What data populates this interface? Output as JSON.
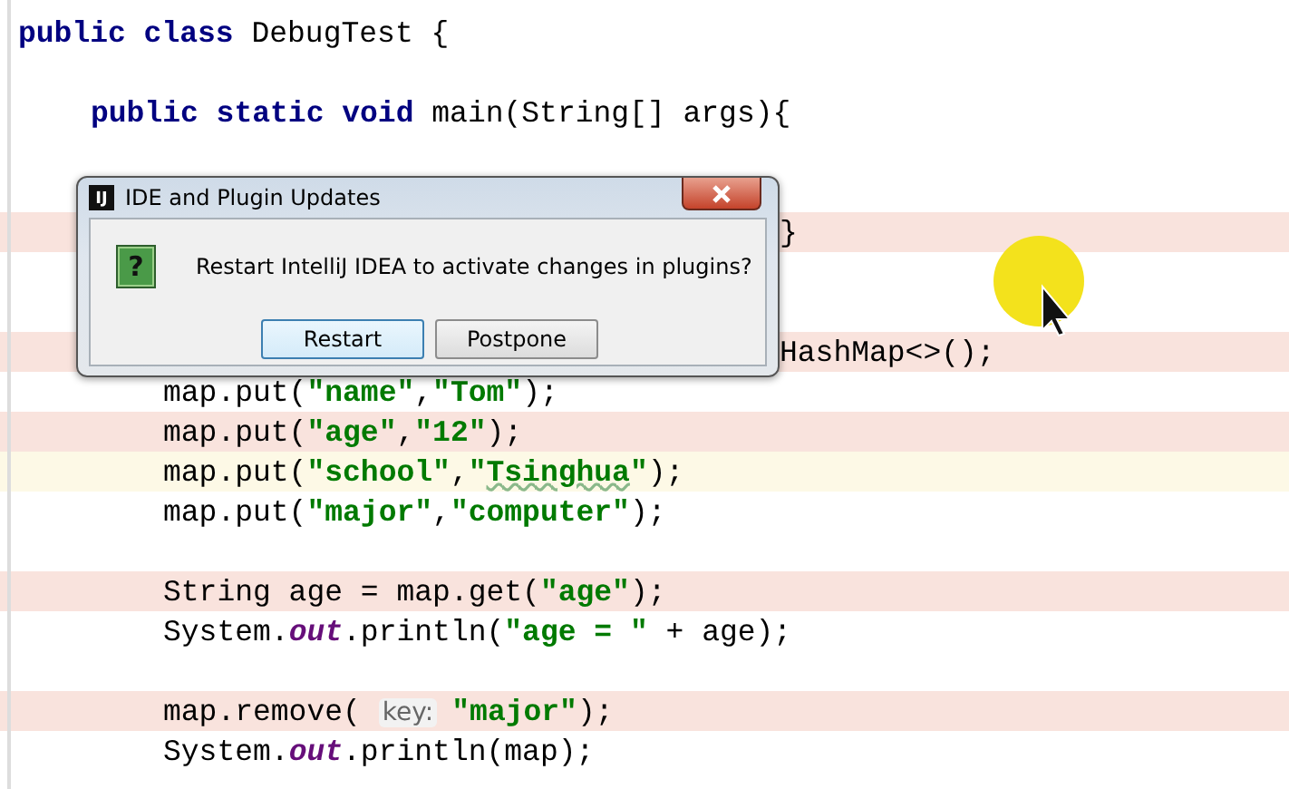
{
  "editor": {
    "lines": [
      {
        "kind": "class",
        "breakpoint": false,
        "current": false,
        "tokens": [
          {
            "kind": "keyword",
            "text": "public class"
          },
          {
            "kind": "plain",
            "text": " DebugTest {"
          }
        ]
      },
      {
        "kind": "blank",
        "breakpoint": false,
        "current": false
      },
      {
        "kind": "member",
        "breakpoint": false,
        "current": false,
        "tokens": [
          {
            "kind": "keyword",
            "text": "public static void"
          },
          {
            "kind": "plain",
            "text": " main(String[] args){"
          }
        ]
      },
      {
        "kind": "blank",
        "breakpoint": false,
        "current": false
      },
      {
        "kind": "blank",
        "breakpoint": false,
        "current": false
      },
      {
        "kind": "covered",
        "breakpoint": true,
        "current": false,
        "tokens": [
          {
            "kind": "plain",
            "text": "}"
          }
        ]
      },
      {
        "kind": "blank",
        "breakpoint": false,
        "current": false
      },
      {
        "kind": "blank",
        "breakpoint": false,
        "current": false
      },
      {
        "kind": "covered",
        "breakpoint": true,
        "current": false,
        "tokens": [
          {
            "kind": "plain",
            "text": "HashMap<>();"
          }
        ]
      },
      {
        "kind": "body",
        "breakpoint": false,
        "current": false,
        "tokens": [
          {
            "kind": "plain",
            "text": "map.put("
          },
          {
            "kind": "string",
            "text": "\"name\""
          },
          {
            "kind": "plain",
            "text": ","
          },
          {
            "kind": "string",
            "text": "\"Tom\""
          },
          {
            "kind": "plain",
            "text": ");"
          }
        ]
      },
      {
        "kind": "body",
        "breakpoint": true,
        "current": false,
        "tokens": [
          {
            "kind": "plain",
            "text": "map.put("
          },
          {
            "kind": "string",
            "text": "\"age\""
          },
          {
            "kind": "plain",
            "text": ","
          },
          {
            "kind": "string",
            "text": "\"12\""
          },
          {
            "kind": "plain",
            "text": ");"
          }
        ]
      },
      {
        "kind": "body",
        "breakpoint": false,
        "current": true,
        "tokens": [
          {
            "kind": "plain",
            "text": "map.put("
          },
          {
            "kind": "string",
            "text": "\"school\""
          },
          {
            "kind": "plain",
            "text": ","
          },
          {
            "kind": "string",
            "text": "\""
          },
          {
            "kind": "typo",
            "text": "Tsinghua"
          },
          {
            "kind": "string",
            "text": "\""
          },
          {
            "kind": "plain",
            "text": ");"
          }
        ]
      },
      {
        "kind": "body",
        "breakpoint": false,
        "current": false,
        "tokens": [
          {
            "kind": "plain",
            "text": "map.put("
          },
          {
            "kind": "string",
            "text": "\"major\""
          },
          {
            "kind": "plain",
            "text": ","
          },
          {
            "kind": "string",
            "text": "\"computer\""
          },
          {
            "kind": "plain",
            "text": ");"
          }
        ]
      },
      {
        "kind": "blank",
        "breakpoint": false,
        "current": false
      },
      {
        "kind": "body",
        "breakpoint": true,
        "current": false,
        "tokens": [
          {
            "kind": "plain",
            "text": "String age = map.get("
          },
          {
            "kind": "string",
            "text": "\"age\""
          },
          {
            "kind": "plain",
            "text": ");"
          }
        ]
      },
      {
        "kind": "body",
        "breakpoint": false,
        "current": false,
        "tokens": [
          {
            "kind": "plain",
            "text": "System."
          },
          {
            "kind": "field",
            "text": "out"
          },
          {
            "kind": "plain",
            "text": ".println("
          },
          {
            "kind": "string",
            "text": "\"age = \""
          },
          {
            "kind": "plain",
            "text": " + age);"
          }
        ]
      },
      {
        "kind": "blank",
        "breakpoint": false,
        "current": false
      },
      {
        "kind": "body",
        "breakpoint": true,
        "current": false,
        "tokens": [
          {
            "kind": "plain",
            "text": "map.remove("
          },
          {
            "kind": "hint",
            "text": "key:"
          },
          {
            "kind": "string",
            "text": "\"major\""
          },
          {
            "kind": "plain",
            "text": ");"
          }
        ]
      },
      {
        "kind": "body",
        "breakpoint": false,
        "current": false,
        "tokens": [
          {
            "kind": "plain",
            "text": "System."
          },
          {
            "kind": "field",
            "text": "out"
          },
          {
            "kind": "plain",
            "text": ".println(map);"
          }
        ]
      }
    ]
  },
  "dialog": {
    "app_icon": "IJ",
    "title": "IDE and Plugin Updates",
    "icon": "?",
    "message": "Restart IntelliJ IDEA to activate changes in plugins?",
    "buttons": [
      {
        "label": "Restart",
        "focused": true
      },
      {
        "label": "Postpone",
        "focused": false
      }
    ]
  }
}
